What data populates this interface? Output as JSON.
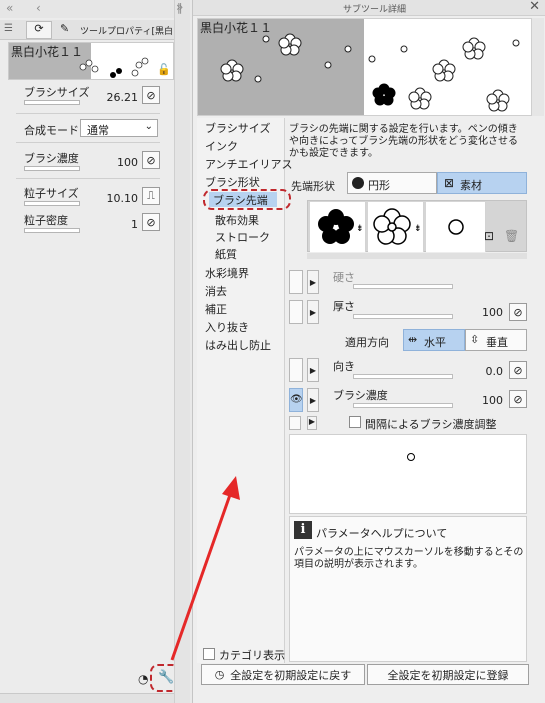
{
  "left_panel": {
    "tab_label": "ツールプロパティ[黒白",
    "brush_name": "黒白小花１１",
    "props": [
      {
        "label": "ブラシサイズ",
        "value": "26.21"
      },
      {
        "label": "合成モード",
        "value": "通常"
      },
      {
        "label": "ブラシ濃度",
        "value": "100"
      },
      {
        "label": "粒子サイズ",
        "value": "10.10"
      },
      {
        "label": "粒子密度",
        "value": "1"
      }
    ]
  },
  "right_panel": {
    "title": "サブツール詳細",
    "preview_name": "黒白小花１１",
    "categories": [
      {
        "label": "ブラシサイズ",
        "sub": false
      },
      {
        "label": "インク",
        "sub": false
      },
      {
        "label": "アンチエイリアス",
        "sub": false
      },
      {
        "label": "ブラシ形状",
        "sub": false
      },
      {
        "label": "ブラシ先端",
        "sub": false,
        "selected": true
      },
      {
        "label": "散布効果",
        "sub": true
      },
      {
        "label": "ストローク",
        "sub": true
      },
      {
        "label": "紙質",
        "sub": true
      },
      {
        "label": "水彩境界",
        "sub": false
      },
      {
        "label": "消去",
        "sub": false
      },
      {
        "label": "補正",
        "sub": false
      },
      {
        "label": "入り抜き",
        "sub": false
      },
      {
        "label": "はみ出し防止",
        "sub": false
      }
    ],
    "description": "ブラシの先端に関する設定を行います。ペンの傾きや向きによってブラシ先端の形状をどう変化させるかも設定できます。",
    "tip_shape_label": "先端形状",
    "tip_shape_options": [
      "円形",
      "素材"
    ],
    "hardness_label": "硬さ",
    "thickness_label": "厚さ",
    "thickness_value": "100",
    "apply_direction_label": "適用方向",
    "direction_options": [
      "水平",
      "垂直"
    ],
    "direction_label": "向き",
    "direction_value": "0.0",
    "density_label": "ブラシ濃度",
    "density_value": "100",
    "interval_density_label": "間隔によるブラシ濃度調整",
    "help_title": "パラメータヘルプについて",
    "help_text": "パラメータの上にマウスカーソルを移動するとその項目の説明が表示されます。",
    "category_display_label": "カテゴリ表示",
    "reset_button": "全設定を初期設定に戻す",
    "register_button": "全設定を初期設定に登録",
    "icons": [
      "menu-icon",
      "wrench-icon",
      "eye-icon",
      "lock-icon",
      "info-icon",
      "trash-icon"
    ]
  },
  "colors": {
    "selection_blue": "#b7d2f0",
    "highlight_red": "#c0282d",
    "arrow_red": "#e52828"
  }
}
